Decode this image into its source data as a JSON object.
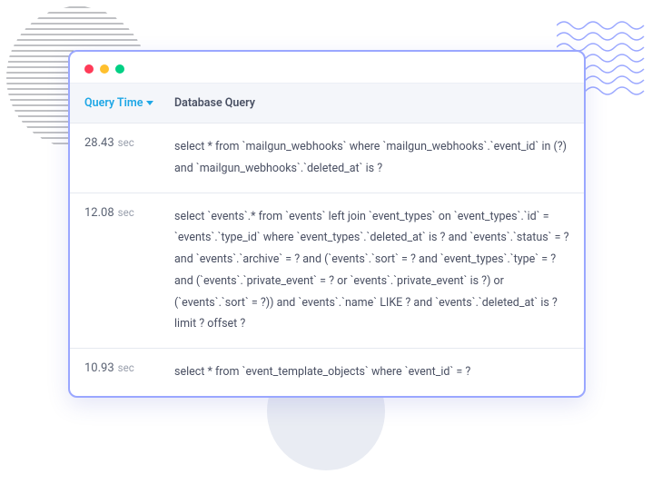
{
  "headers": {
    "time": "Query Time",
    "query": "Database Query"
  },
  "rows": [
    {
      "time_val": "28.43",
      "time_unit": "sec",
      "query": "select * from `mailgun_webhooks` where `mailgun_webhooks`.`event_id` in (?) and `mailgun_webhooks`.`deleted_at` is ?"
    },
    {
      "time_val": "12.08",
      "time_unit": "sec",
      "query": "select `events`.* from `events` left join `event_types` on `event_types`.`id` = `events`.`type_id` where `event_types`.`deleted_at` is ? and `events`.`status` = ? and `events`.`archive` = ? and (`events`.`sort` = ? and `event_types`.`type` = ? and (`events`.`private_event` = ? or `events`.`private_event` is ?) or (`events`.`sort` = ?)) and `events`.`name` LIKE ? and `events`.`deleted_at` is ? limit ? offset ?"
    },
    {
      "time_val": "10.93",
      "time_unit": "sec",
      "query": "select * from `event_template_objects` where `event_id` = ?"
    }
  ]
}
